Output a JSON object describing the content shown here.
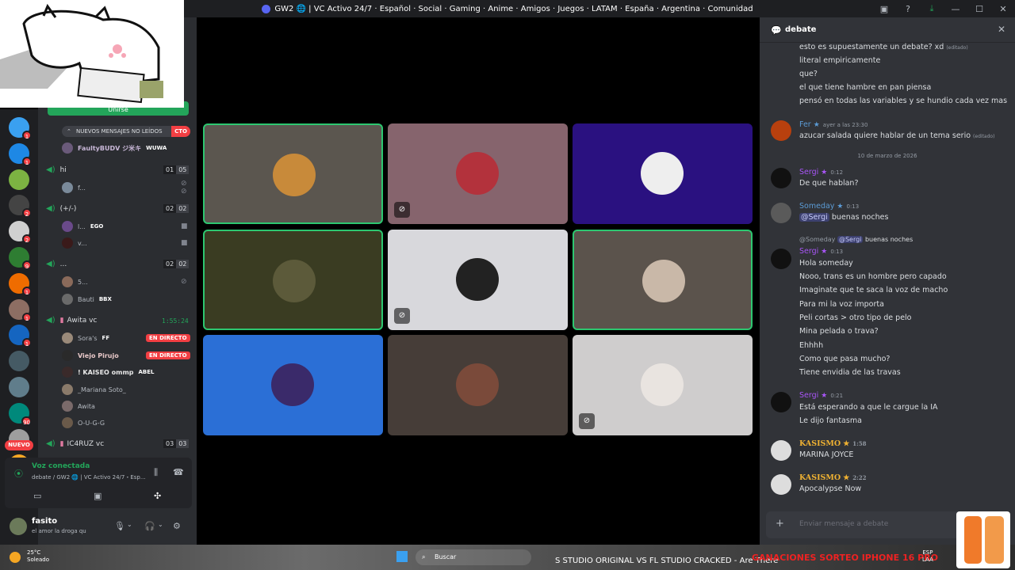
{
  "window": {
    "title": "GW2 🌐 | VC Activo 24/7 · Español · Social · Gaming · Anime · Amigos · Juegos · LATAM · España · Argentina · Comunidad"
  },
  "servers": {
    "badges": [
      "1",
      "1",
      "",
      "2",
      "2",
      "9",
      "1",
      "1",
      "1",
      "",
      "",
      "90",
      "",
      "",
      ""
    ],
    "new_label": "NUEVO"
  },
  "sidebar": {
    "join_label": "Unirse",
    "new_messages_label": "NUEVOS MENSAJES NO LEÍDOS",
    "new_messages_live": "CTO",
    "top_user": {
      "name": "FaultyBUDV ジ米キ",
      "tag": "WUWA"
    },
    "channels": [
      {
        "name": "hi",
        "count_a": "01",
        "count_b": "05"
      },
      {
        "name": "(+/-)",
        "count_a": "02",
        "count_b": "02"
      },
      {
        "name": "...",
        "count_a": "02",
        "count_b": "02"
      },
      {
        "name": "Awita vc"
      },
      {
        "name": "IC4RUZ vc",
        "count_a": "03",
        "count_b": "03"
      }
    ],
    "timer": "1:55:24",
    "users_hi": [
      {
        "name": "f..."
      }
    ],
    "users_pm": [
      {
        "name": "l...",
        "tag": "EGO"
      },
      {
        "name": "v..."
      }
    ],
    "users_dots": [
      {
        "name": "5..."
      },
      {
        "name": "Bauti",
        "tag": "BBX"
      }
    ],
    "users_awita": [
      {
        "name": "Sora's",
        "tag": "FF",
        "live": "EN DIRECTO"
      },
      {
        "name": "Viejo Pirujo",
        "live": "EN DIRECTO"
      },
      {
        "name": "! KAISEO ommp",
        "tag": "ABEL"
      },
      {
        "name": "_Mariana Soto_"
      },
      {
        "name": "Awita"
      },
      {
        "name": "O-U-G-G"
      }
    ]
  },
  "voice": {
    "status": "Voz conectada",
    "channel": "debate / GW2 🌐 | VC Activo 24/7・Esp..."
  },
  "user": {
    "name": "fasito",
    "status": "el amor la droga qu"
  },
  "grid": {
    "tiles": [
      {
        "bg": "#5b564f",
        "speaking": true,
        "muted": false,
        "av": "#c88a3a"
      },
      {
        "bg": "#86646d",
        "speaking": false,
        "muted": true,
        "av": "#b3323c"
      },
      {
        "bg": "#2a1180",
        "speaking": false,
        "muted": false,
        "av": "#eeeeee"
      },
      {
        "bg": "#3a3c22",
        "speaking": true,
        "muted": false,
        "av": "#5c5a3a"
      },
      {
        "bg": "#d8d8dc",
        "speaking": false,
        "muted": true,
        "av": "#222222"
      },
      {
        "bg": "#5b534c",
        "speaking": true,
        "muted": false,
        "av": "#c9b8a8"
      },
      {
        "bg": "#2b6fd6",
        "speaking": false,
        "muted": false,
        "av": "#3a2a6a"
      },
      {
        "bg": "#463d38",
        "speaking": false,
        "muted": false,
        "av": "#7a4a3a"
      },
      {
        "bg": "#cfcdcd",
        "speaking": false,
        "muted": true,
        "av": "#e9e4e0"
      }
    ]
  },
  "chat": {
    "channel_name": "debate",
    "edited_label": "(editado)",
    "lines_top": [
      "esto es supuestamente un debate? xd",
      "literal empiricamente",
      "que?",
      "el que tiene hambre en pan piensa",
      "pensó en todas las variables y se hundio cada vez mas"
    ],
    "fer": {
      "name": "Fer",
      "time": "ayer a las 23:30",
      "text": "azucar salada quiere hablar de un tema serio"
    },
    "date_divider": "10 de marzo de 2026",
    "sergi1": {
      "name": "Sergi",
      "time": "0:12",
      "text": "De que hablan?"
    },
    "someday": {
      "name": "Someday",
      "time": "0:13",
      "mention": "@Sergi",
      "text": "buenas noches"
    },
    "reply": {
      "who": "@Someday",
      "mention": "@Sergi",
      "text": "buenas noches"
    },
    "sergi2": {
      "name": "Sergi",
      "time": "0:13",
      "lines": [
        "Hola someday",
        "Nooo, trans es un hombre pero capado",
        "Imaginate que te saca la voz de macho",
        "Para mi la voz importa",
        "Peli cortas > otro tipo de pelo",
        "Mina pelada o trava?",
        "Ehhhh",
        "Como que pasa mucho?",
        "Tiene envidia de las travas"
      ]
    },
    "sergi3": {
      "name": "Sergi",
      "time": "0:21",
      "lines": [
        "Está esperando a que le cargue la IA",
        "Le dijo fantasma"
      ]
    },
    "kasismo1": {
      "name": "KASISMO",
      "time": "1:58",
      "text": "MARINA JOYCE"
    },
    "kasismo2": {
      "name": "KASISMO",
      "time": "2:22",
      "text": "Apocalypse Now"
    },
    "input_placeholder": "Enviar mensaje a debate"
  },
  "taskbar": {
    "temp": "25°C",
    "weather": "Soleado",
    "search": "Buscar",
    "ticker": "S STUDIO ORIGINAL VS FL STUDIO CRACKED - Are There",
    "ticker2": "GANACIONES SORTEO IPHONE 16 PRO",
    "lang_a": "ESP",
    "lang_b": "LAA"
  },
  "colors": {
    "accent": "#5865f2",
    "speaking": "#2dc770",
    "live": "#f23f43",
    "sergi": "#a855f7",
    "someday": "#5b9bd5",
    "kasismo": "#f0b232"
  }
}
